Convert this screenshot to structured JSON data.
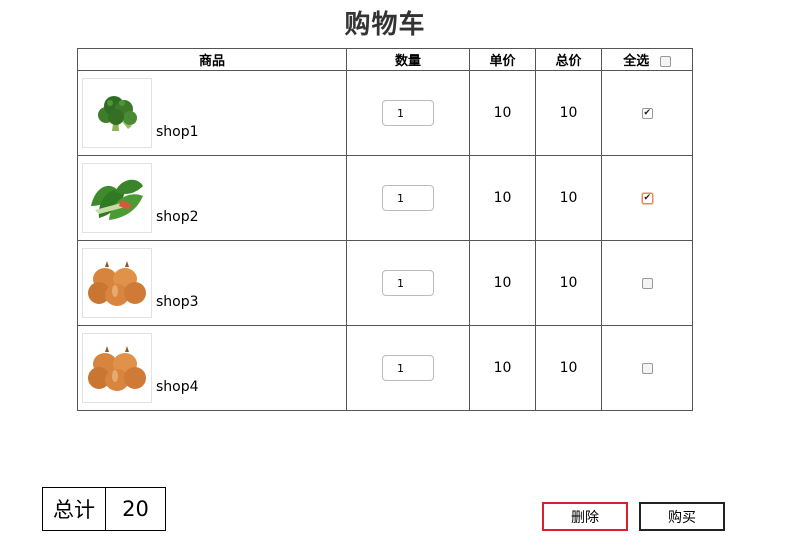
{
  "title": "购物车",
  "headers": {
    "product": "商品",
    "quantity": "数量",
    "unit_price": "单价",
    "total_price": "总价",
    "select_all": "全选"
  },
  "select_all_checked": false,
  "rows": [
    {
      "name": "shop1",
      "qty": "1",
      "unit_price": "10",
      "total": "10",
      "checked": true,
      "image": "broccoli-image"
    },
    {
      "name": "shop2",
      "qty": "1",
      "unit_price": "10",
      "total": "10",
      "checked": true,
      "image": "spinach-image"
    },
    {
      "name": "shop3",
      "qty": "1",
      "unit_price": "10",
      "total": "10",
      "checked": false,
      "image": "onions-image"
    },
    {
      "name": "shop4",
      "qty": "1",
      "unit_price": "10",
      "total": "10",
      "checked": false,
      "image": "onions-image"
    }
  ],
  "footer": {
    "total_label": "总计",
    "total_value": "20",
    "delete_label": "删除",
    "buy_label": "购买"
  },
  "colors": {
    "delete_border": "#d9202c",
    "checkbox_focus": "#e58a5c"
  }
}
